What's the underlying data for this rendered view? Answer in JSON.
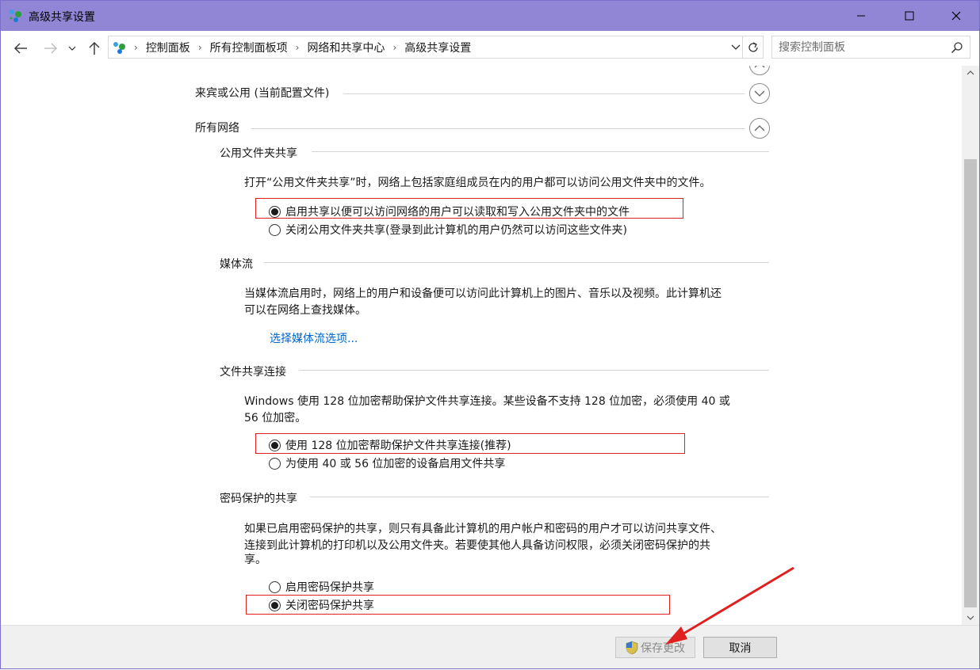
{
  "window": {
    "title": "高级共享设置",
    "buttons": {
      "minimize": "minimize-icon",
      "maximize": "maximize-icon",
      "close": "close-icon"
    }
  },
  "nav": {
    "breadcrumbs": [
      "控制面板",
      "所有控制面板项",
      "网络和共享中心",
      "高级共享设置"
    ],
    "search_placeholder": "搜索控制面板"
  },
  "sections": {
    "guest": {
      "label": "来宾或公用 (当前配置文件)"
    },
    "all": {
      "label": "所有网络"
    }
  },
  "public_folder": {
    "title": "公用文件夹共享",
    "description": "打开“公用文件夹共享”时，网络上包括家庭组成员在内的用户都可以访问公用文件夹中的文件。",
    "options": [
      {
        "label": "启用共享以便可以访问网络的用户可以读取和写入公用文件夹中的文件",
        "selected": true
      },
      {
        "label": "关闭公用文件夹共享(登录到此计算机的用户仍然可以访问这些文件夹)",
        "selected": false
      }
    ]
  },
  "media": {
    "title": "媒体流",
    "description_line1": "当媒体流启用时，网络上的用户和设备便可以访问此计算机上的图片、音乐以及视频。此计算机还",
    "description_line2": "可以在网络上查找媒体。",
    "link": "选择媒体流选项..."
  },
  "file_sharing": {
    "title": "文件共享连接",
    "description_line1": "Windows 使用 128 位加密帮助保护文件共享连接。某些设备不支持 128 位加密，必须使用 40 或",
    "description_line2": "56 位加密。",
    "options": [
      {
        "label": "使用 128 位加密帮助保护文件共享连接(推荐)",
        "selected": true
      },
      {
        "label": "为使用 40 或 56 位加密的设备启用文件共享",
        "selected": false
      }
    ]
  },
  "password": {
    "title": "密码保护的共享",
    "description_line1": "如果已启用密码保护的共享，则只有具备此计算机的用户帐户和密码的用户才可以访问共享文件、",
    "description_line2": "连接到此计算机的打印机以及公用文件夹。若要使其他人具备访问权限，必须关闭密码保护的共",
    "description_line3": "享。",
    "options": [
      {
        "label": "启用密码保护共享",
        "selected": false
      },
      {
        "label": "关闭密码保护共享",
        "selected": true
      }
    ]
  },
  "footer": {
    "save": "保存更改",
    "cancel": "取消"
  },
  "colors": {
    "titlebar": "#9186d5",
    "highlight_box": "#e02020",
    "link": "#0066cc"
  }
}
